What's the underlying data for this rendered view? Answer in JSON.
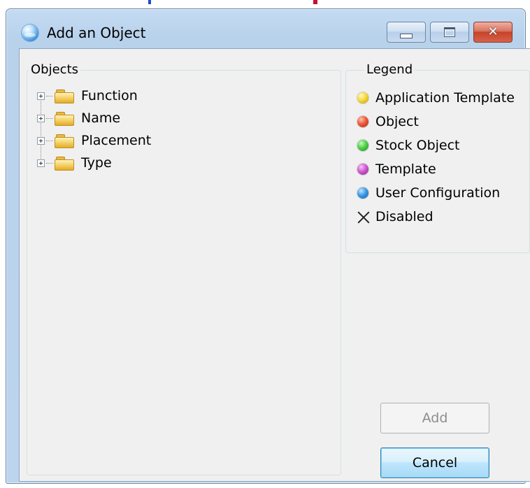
{
  "window": {
    "title": "Add an Object"
  },
  "objects_panel": {
    "label": "Objects",
    "items": [
      {
        "label": "Function"
      },
      {
        "label": "Name"
      },
      {
        "label": "Placement"
      },
      {
        "label": "Type"
      }
    ]
  },
  "legend_panel": {
    "label": "Legend",
    "items": [
      {
        "label": "Application Template",
        "color": "#f0c419",
        "icon": "yellow-ball-icon"
      },
      {
        "label": "Object",
        "color": "#e0432b",
        "icon": "red-ball-icon"
      },
      {
        "label": "Stock Object",
        "color": "#3cc23c",
        "icon": "green-ball-icon"
      },
      {
        "label": "Template",
        "color": "#c64ac9",
        "icon": "purple-ball-icon"
      },
      {
        "label": "User Configuration",
        "color": "#2e8fdc",
        "icon": "blue-ball-icon"
      },
      {
        "label": "Disabled",
        "icon": "x-icon"
      }
    ]
  },
  "buttons": {
    "add_label": "Add",
    "cancel_label": "Cancel"
  }
}
